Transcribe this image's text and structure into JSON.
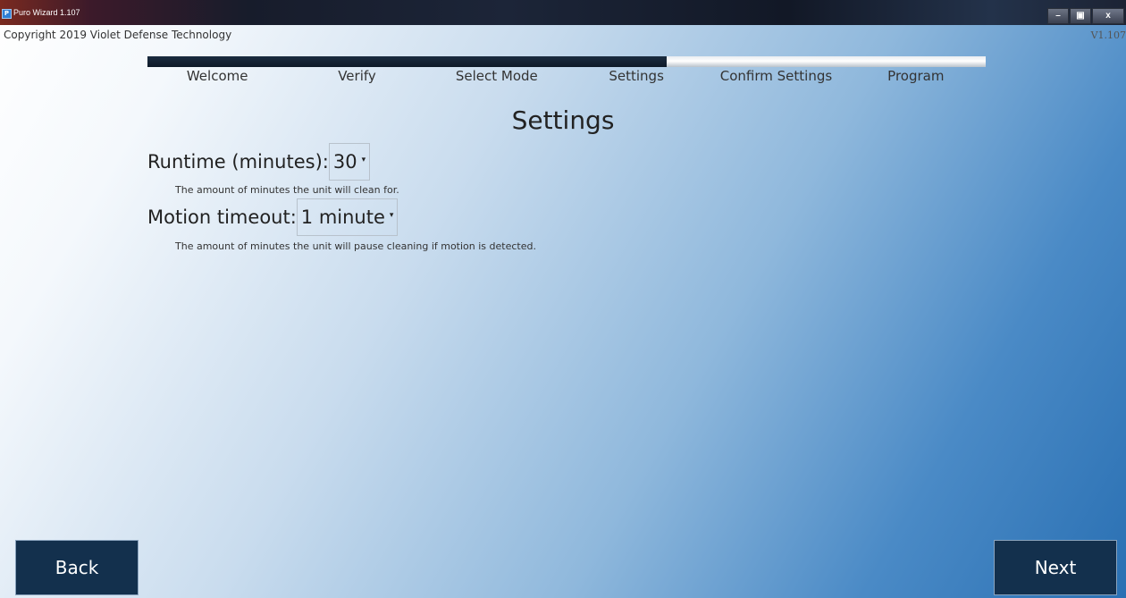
{
  "window": {
    "title": "Puro Wizard 1.107",
    "app_icon_glyph": "P",
    "minimize_glyph": "–",
    "restore_glyph": "▣",
    "close_glyph": "x"
  },
  "header": {
    "copyright": "Copyright 2019 Violet Defense Technology",
    "version": "V1.107"
  },
  "progress": {
    "fraction": 0.619,
    "steps": [
      "Welcome",
      "Verify",
      "Select Mode",
      "Settings",
      "Confirm Settings",
      "Program"
    ],
    "current_step": "Settings"
  },
  "page": {
    "title": "Settings"
  },
  "runtime": {
    "label": "Runtime (minutes):",
    "value": "30",
    "hint": "The amount of minutes the unit will clean for."
  },
  "motion_timeout": {
    "label": "Motion timeout:",
    "value": "1 minute",
    "hint": "The amount of minutes the unit will pause cleaning if motion is detected."
  },
  "nav": {
    "back_label": "Back",
    "next_label": "Next"
  },
  "colors": {
    "nav_button": "#13304d",
    "progress_fill": "#0e1a28"
  }
}
